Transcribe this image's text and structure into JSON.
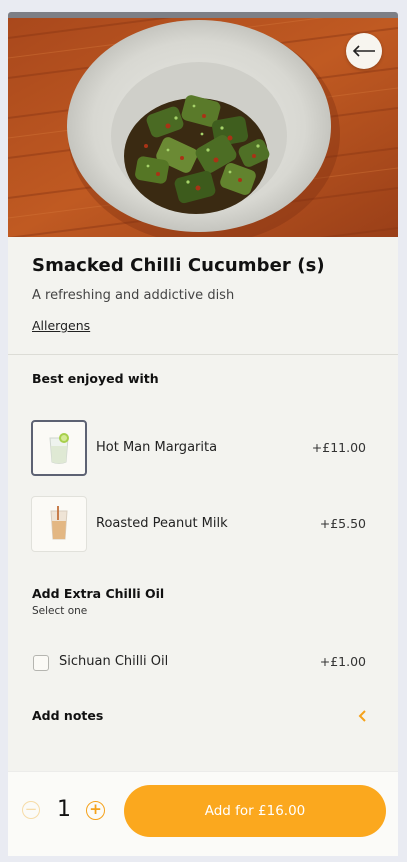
{
  "product": {
    "title": "Smacked Chilli Cucumber (s)",
    "description": "A refreshing and addictive dish",
    "allergens_link": "Allergens"
  },
  "pairings": {
    "title": "Best enjoyed with",
    "items": [
      {
        "name": "Hot Man Margarita",
        "price": "+£11.00",
        "icon": "margarita-glass-icon",
        "selected": true
      },
      {
        "name": "Roasted Peanut Milk",
        "price": "+£5.50",
        "icon": "peanut-milk-glass-icon",
        "selected": false
      }
    ]
  },
  "extras": {
    "title": "Add Extra Chilli Oil",
    "subtitle": "Select one",
    "options": [
      {
        "name": "Sichuan Chilli Oil",
        "price": "+£1.00",
        "checked": false
      }
    ]
  },
  "notes": {
    "label": "Add notes"
  },
  "footer": {
    "quantity": "1",
    "minus_symbol": "−",
    "plus_symbol": "+",
    "add_button_label": "Add for £16.00"
  },
  "colors": {
    "accent": "#fba81e",
    "background": "#f3f3ef"
  }
}
